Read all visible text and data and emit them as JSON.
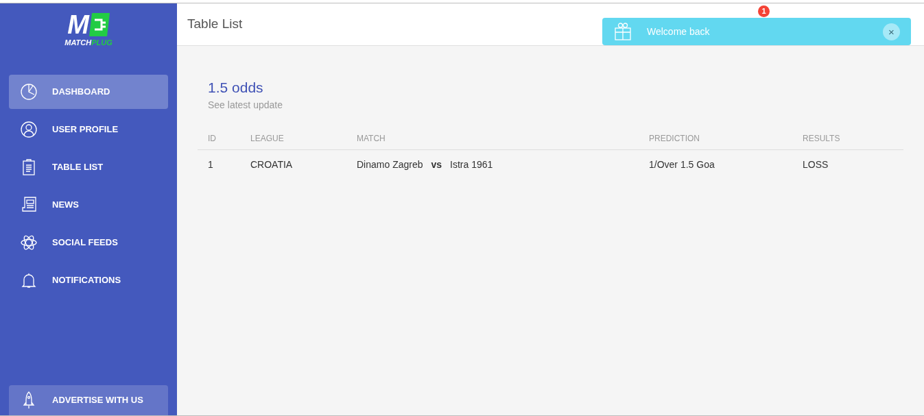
{
  "logo": {
    "mark": "M",
    "wordmark_1": "MATCH",
    "wordmark_2": "PLUG"
  },
  "sidebar": {
    "items": [
      {
        "label": "DASHBOARD",
        "selected": true
      },
      {
        "label": "USER PROFILE",
        "selected": false
      },
      {
        "label": "TABLE LIST",
        "selected": false
      },
      {
        "label": "NEWS",
        "selected": false
      },
      {
        "label": "SOCIAL FEEDS",
        "selected": false
      },
      {
        "label": "NOTIFICATIONS",
        "selected": false
      }
    ],
    "footer_item": {
      "label": "ADVERTISE WITH US"
    }
  },
  "header": {
    "title": "Table List",
    "notification_count": "1"
  },
  "toast": {
    "message": "Welcome back",
    "close": "×"
  },
  "card": {
    "title": "1.5 odds",
    "subtitle": "See latest update"
  },
  "table": {
    "columns": [
      "ID",
      "LEAGUE",
      "MATCH",
      "PREDICTION",
      "RESULTS"
    ],
    "rows": [
      {
        "id": "1",
        "league": "CROATIA",
        "home": "Dinamo Zagreb",
        "vs": "vs",
        "away": "Istra 1961",
        "prediction": "1/Over 1.5 Goa",
        "result": "LOSS"
      }
    ]
  }
}
